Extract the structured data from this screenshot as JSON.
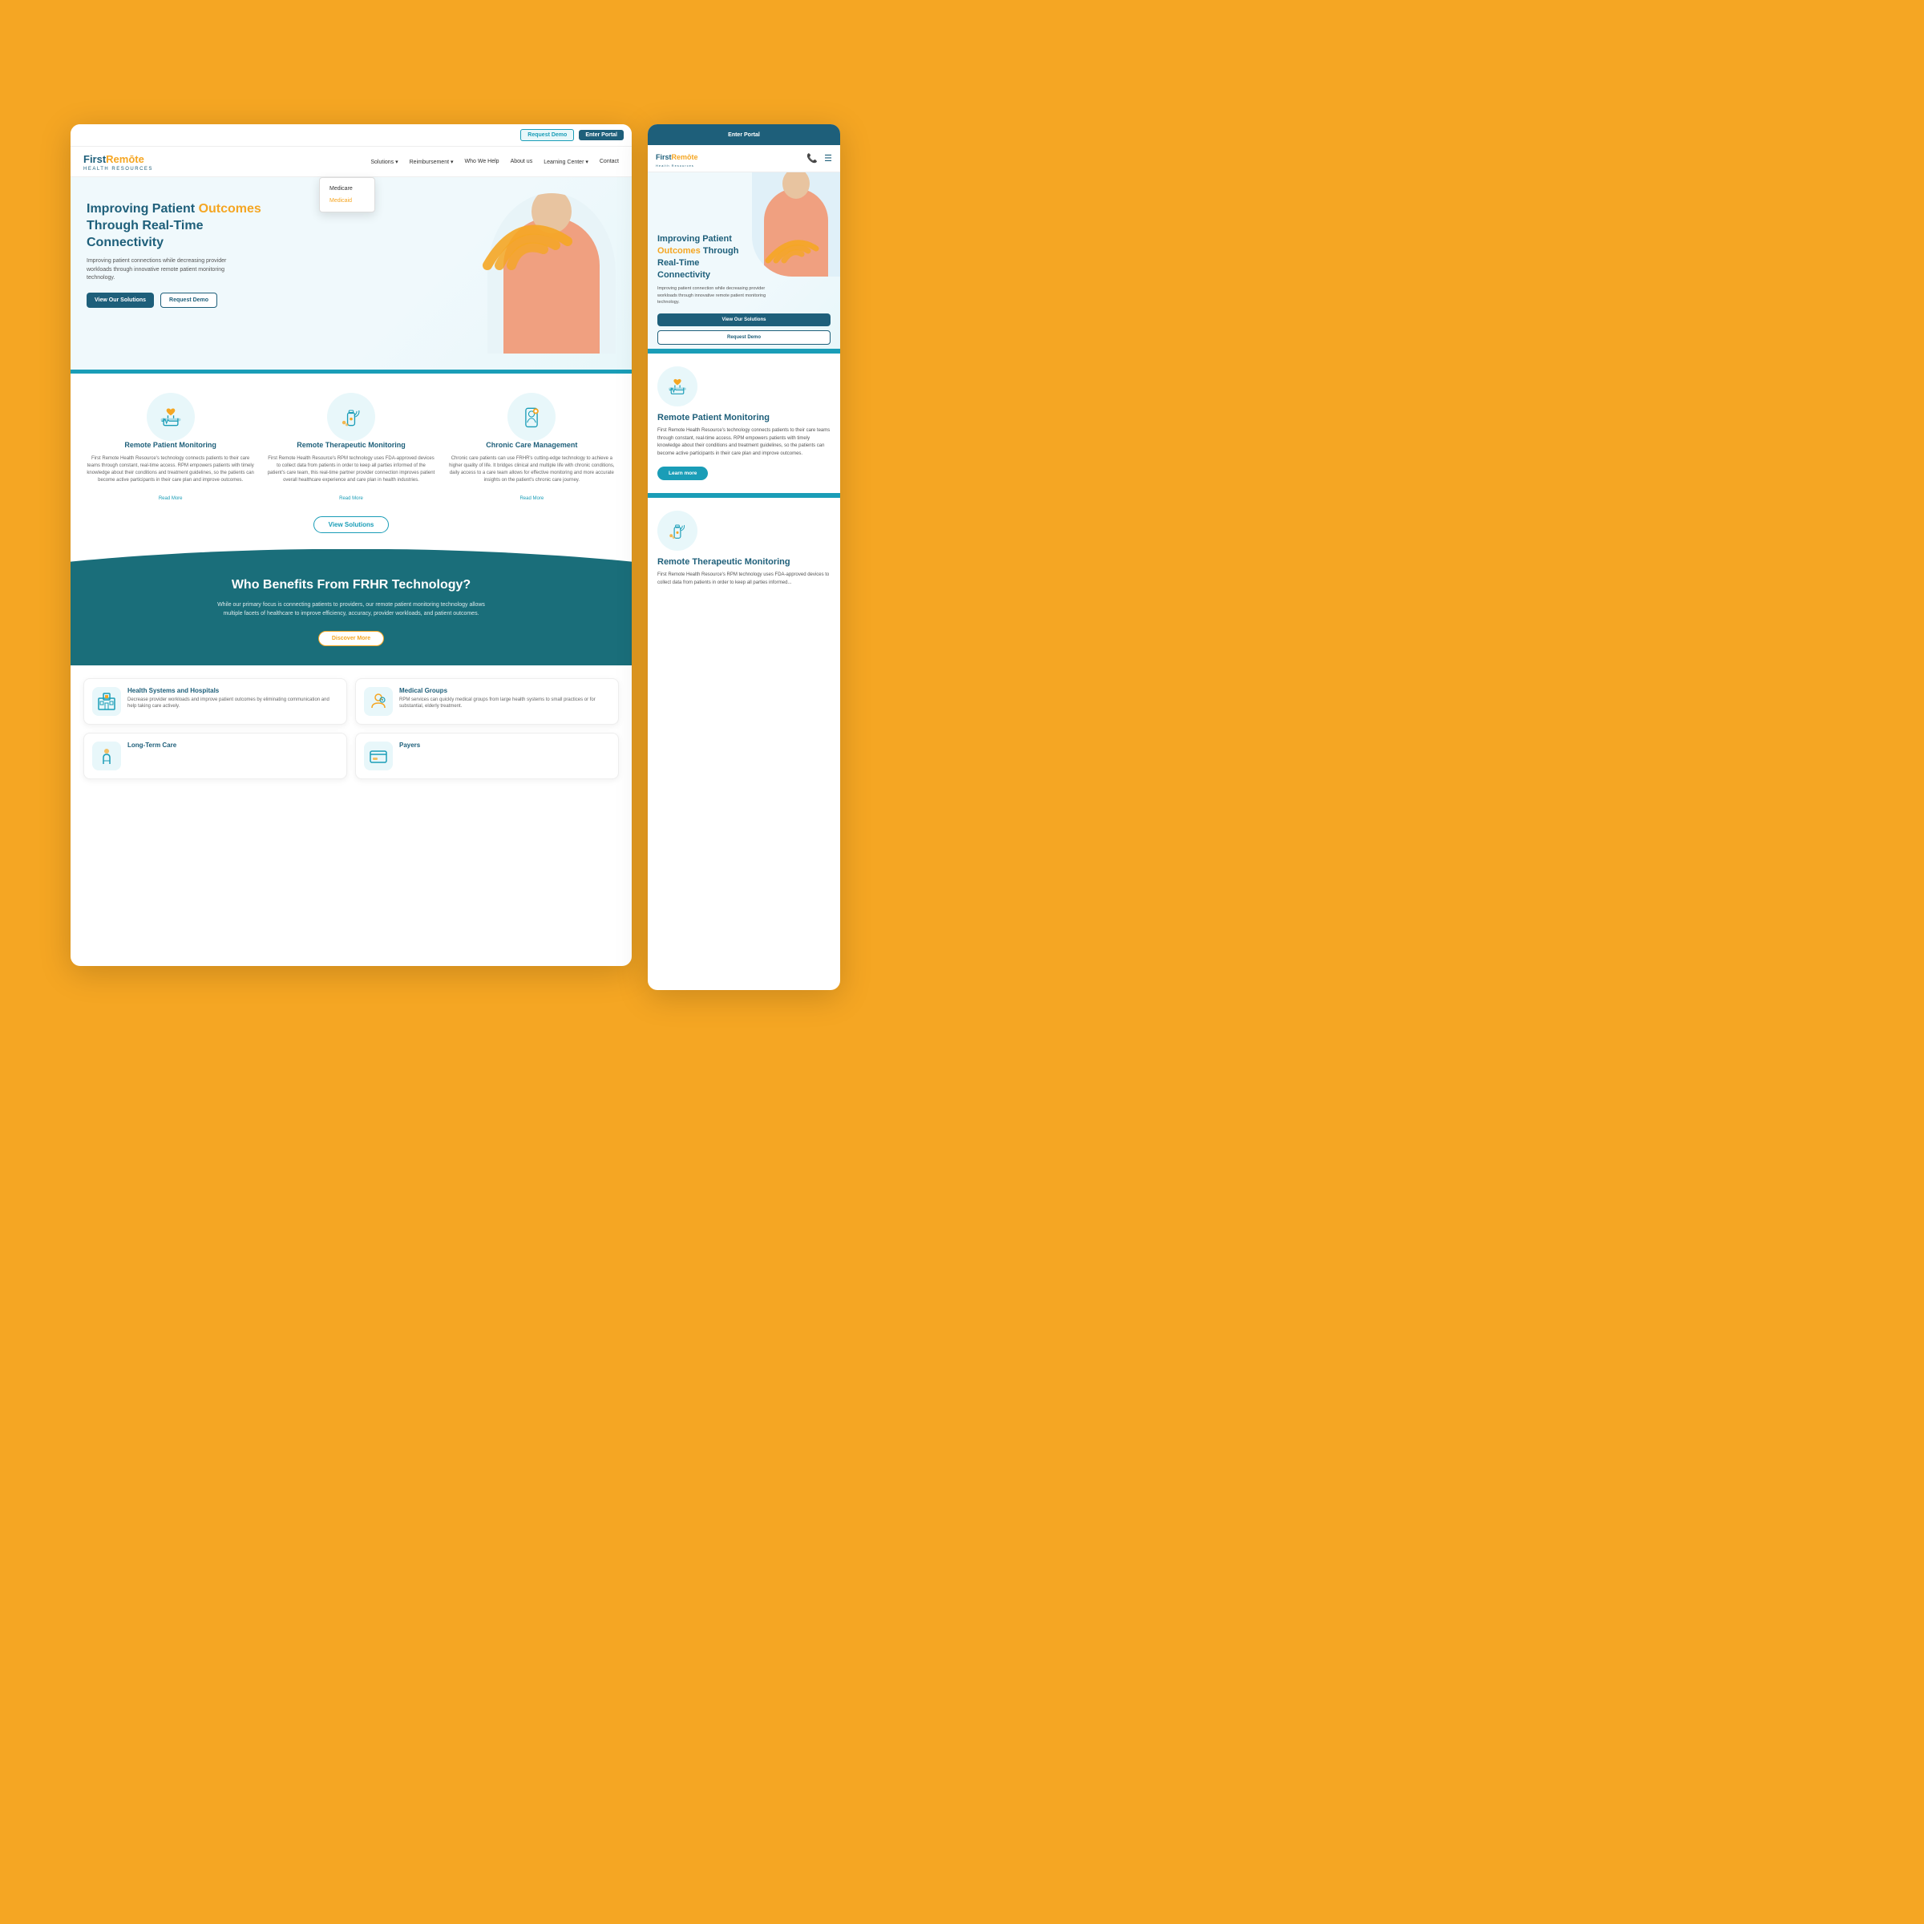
{
  "page": {
    "background_color": "#F5A623"
  },
  "desktop": {
    "topbar": {
      "demo_label": "Request Demo",
      "portal_label": "Enter Portal"
    },
    "nav": {
      "logo_first": "First",
      "logo_remote": "Remōte",
      "logo_sub": "HEALTH RESOURCES",
      "links": [
        {
          "label": "Solutions",
          "has_dropdown": true
        },
        {
          "label": "Reimbursement",
          "has_dropdown": true
        },
        {
          "label": "Who We Help"
        },
        {
          "label": "About us"
        },
        {
          "label": "Learning Center",
          "has_dropdown": true
        },
        {
          "label": "Contact"
        }
      ],
      "dropdown": {
        "items": [
          {
            "label": "Medicare"
          },
          {
            "label": "Medicaid",
            "active": true
          }
        ]
      }
    },
    "hero": {
      "title_part1": "Improving Patient",
      "title_highlight": "Outcomes",
      "title_part2": "Through Real-Time Connectivity",
      "subtitle": "Improving patient connections while decreasing provider workloads through innovative remote patient monitoring technology.",
      "btn_solutions": "View Our Solutions",
      "btn_demo": "Request Demo"
    },
    "solutions": {
      "items": [
        {
          "icon": "hand-heart",
          "title": "Remote Patient Monitoring",
          "text": "First Remote Health Resource's technology connects patients to their care teams through constant, real-time access. RPM empowers patients with timely knowledge about their conditions and treatment guidelines, so the patients can become active participants in their care plan and improve outcomes.",
          "read_more": "Read More"
        },
        {
          "icon": "bottle-wifi",
          "title": "Remote Therapeutic Monitoring",
          "text": "First Remote Health Resource's RPM technology uses FDA-approved devices to collect data from patients in order to keep all parties informed of the patient's care team, this real-time partner provider connection improves patient overall healthcare experience and care plan in health industries.",
          "read_more": "Read More"
        },
        {
          "icon": "phone-person",
          "title": "Chronic Care Management",
          "text": "Chronic care patients can use FRHR's cutting-edge technology to achieve a higher quality of life. It bridges clinical and multiple life with chronic conditions, daily access to a care team allows for effective monitoring and more accurate insights on the patient's chronic care journey.",
          "read_more": "Read More"
        }
      ],
      "view_solutions_label": "View Solutions"
    },
    "who_benefits": {
      "title": "Who Benefits From FRHR Technology?",
      "subtitle": "While our primary focus is connecting patients to providers, our remote patient monitoring technology allows multiple facets of healthcare to improve efficiency, accuracy, provider workloads, and patient outcomes.",
      "btn_discover": "Discover More"
    },
    "benefit_cards": [
      {
        "icon": "hospital",
        "title": "Health Systems and Hospitals",
        "text": "Decrease provider workloads and improve patient outcomes by eliminating communication and help taking care actively."
      },
      {
        "icon": "doctor",
        "title": "Medical Groups",
        "text": "RPM services can quickly medical groups from large health systems to small practices or for substantial, elderly treatment."
      },
      {
        "icon": "care",
        "title": "Long-Term Care",
        "text": ""
      },
      {
        "icon": "payers",
        "title": "Payers",
        "text": ""
      }
    ]
  },
  "mobile": {
    "topbar_label": "Enter Portal",
    "logo_first": "First",
    "logo_remote": "Remōte",
    "logo_sub": "Health Resources",
    "hero": {
      "title_part1": "Improving Patient",
      "title_highlight": "Outcomes",
      "title_part2": "Through Real-Time Connectivity",
      "subtitle": "Improving patient connection while decreasing provider workloads through innovative remote patient monitoring technology.",
      "btn_solutions": "View Our Solutions",
      "btn_demo": "Request Demo"
    },
    "solution1": {
      "title": "Remote Patient Monitoring",
      "text": "First Remote Health Resource's technology connects patients to their care teams through constant, real-time access. RPM empowers patients with timely knowledge about their conditions and treatment guidelines, so the patients can become active participants in their care plan and improve outcomes.",
      "btn_learn": "Learn more"
    },
    "solution2": {
      "title": "Remote Therapeutic Monitoring",
      "text": "First Remote Health Resource's RPM technology..."
    }
  }
}
